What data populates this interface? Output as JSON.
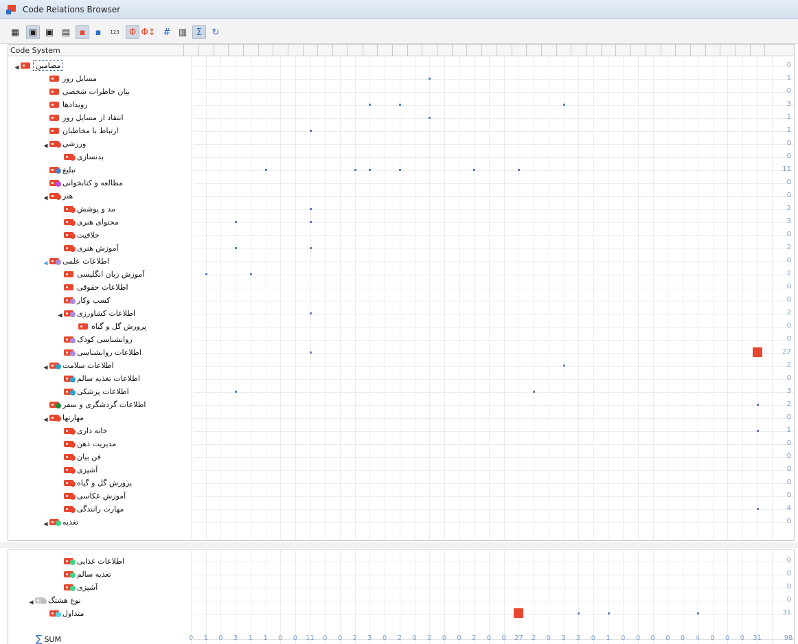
{
  "window": {
    "title": "Code Relations Browser"
  },
  "toolbar": {
    "buttons": [
      {
        "name": "table-view-button",
        "glyph": "▦",
        "on": false
      },
      {
        "name": "layout-a-button",
        "glyph": "▣",
        "on": true
      },
      {
        "name": "layout-b-button",
        "glyph": "▣",
        "on": false
      },
      {
        "name": "layout-c-button",
        "glyph": "▤",
        "on": false
      },
      {
        "name": "symbol-squares-button",
        "glyph": "▪",
        "on": true,
        "color": "#e8472f"
      },
      {
        "name": "symbol-size-button",
        "glyph": "▪",
        "on": false,
        "color": "#2d6fc7"
      },
      {
        "name": "numbers-button",
        "glyph": "123",
        "on": false
      },
      {
        "name": "intersection-button",
        "glyph": "Φ",
        "on": true,
        "color": "#e8472f"
      },
      {
        "name": "proximity-button",
        "glyph": "Φ↕",
        "on": false,
        "color": "#e8472f"
      },
      {
        "name": "hash-button",
        "glyph": "#",
        "on": false,
        "color": "#2d6fc7"
      },
      {
        "name": "columns-button",
        "glyph": "▥",
        "on": false
      },
      {
        "name": "sum-button",
        "glyph": "Σ",
        "on": true,
        "color": "#2d6fc7"
      },
      {
        "name": "refresh-button",
        "glyph": "↻",
        "on": false,
        "color": "#2d6fc7"
      }
    ]
  },
  "header": {
    "column_label": "Code System"
  },
  "colors": {
    "accent": "#e8472f",
    "marker": "#4f7fc4",
    "sum": "#7a9fd0"
  },
  "tree": [
    {
      "label": "مضامین",
      "indent": 0,
      "expand": "▲",
      "dot": "",
      "selected": true,
      "sum": "0",
      "marks": []
    },
    {
      "label": "مسایل روز",
      "indent": 2,
      "expand": "",
      "dot": "",
      "sum": "1",
      "marks": [
        {
          "c": 16
        }
      ]
    },
    {
      "label": "بیان خاطرات شخصی",
      "indent": 2,
      "expand": "",
      "dot": "",
      "sum": "0",
      "marks": []
    },
    {
      "label": "رویدادها",
      "indent": 2,
      "expand": "",
      "dot": "",
      "sum": "3",
      "marks": [
        {
          "c": 12
        },
        {
          "c": 14
        },
        {
          "c": 25
        }
      ]
    },
    {
      "label": "انتقاد از مسایل روز",
      "indent": 2,
      "expand": "",
      "dot": "",
      "sum": "1",
      "marks": [
        {
          "c": 16
        }
      ]
    },
    {
      "label": "ارتباط با مخاطبان",
      "indent": 2,
      "expand": "",
      "dot": "",
      "sum": "1",
      "marks": [
        {
          "c": 8
        }
      ]
    },
    {
      "label": "ورزشی",
      "indent": 2,
      "expand": "▲",
      "dot": "#e8472f",
      "sum": "0",
      "marks": []
    },
    {
      "label": "بدنسازی",
      "indent": 3,
      "expand": "",
      "dot": "#e8472f",
      "sum": "0",
      "marks": []
    },
    {
      "label": "تبلیغ",
      "indent": 2,
      "expand": "",
      "dot": "#4f7fc4",
      "sum": "11",
      "marks": [
        {
          "c": 5
        },
        {
          "c": 11
        },
        {
          "c": 12
        },
        {
          "c": 14
        },
        {
          "c": 19
        },
        {
          "c": 22
        }
      ]
    },
    {
      "label": "مطالعه و کتابخوانی",
      "indent": 2,
      "expand": "",
      "dot": "#c34ad8",
      "sum": "0",
      "marks": []
    },
    {
      "label": "هنر",
      "indent": 2,
      "expand": "▲",
      "dot": "#e8472f",
      "sum": "0",
      "marks": []
    },
    {
      "label": "مد و پوشش",
      "indent": 3,
      "expand": "",
      "dot": "#e8472f",
      "sum": "2",
      "marks": [
        {
          "c": 8
        }
      ]
    },
    {
      "label": "محتوای هنری",
      "indent": 3,
      "expand": "",
      "dot": "#e8472f",
      "sum": "3",
      "marks": [
        {
          "c": 3
        },
        {
          "c": 8
        }
      ]
    },
    {
      "label": "خلاقیت",
      "indent": 3,
      "expand": "",
      "dot": "#e8472f",
      "sum": "0",
      "marks": []
    },
    {
      "label": "آموزش هنری",
      "indent": 3,
      "expand": "",
      "dot": "#e8472f",
      "sum": "2",
      "marks": [
        {
          "c": 3
        },
        {
          "c": 8
        }
      ]
    },
    {
      "label": "اطلاعات علمی",
      "indent": 2,
      "expand": "▲",
      "expandBlue": true,
      "dot": "#a98be0",
      "sum": "0",
      "marks": []
    },
    {
      "label": "آموزش زبان انگلیسی",
      "indent": 3,
      "expand": "",
      "dot": "",
      "sum": "2",
      "marks": [
        {
          "c": 1
        },
        {
          "c": 4
        }
      ]
    },
    {
      "label": "اطلاعات حقوقی",
      "indent": 3,
      "expand": "",
      "dot": "",
      "sum": "0",
      "marks": []
    },
    {
      "label": "کسب وکار",
      "indent": 3,
      "expand": "",
      "dot": "#a98be0",
      "sum": "0",
      "marks": []
    },
    {
      "label": "اطلاعات کشاورزی",
      "indent": 3,
      "expand": "▲",
      "dot": "#a98be0",
      "sum": "2",
      "marks": [
        {
          "c": 8
        }
      ]
    },
    {
      "label": "پرورش گل و گیاه",
      "indent": 4,
      "expand": "",
      "dot": "",
      "sum": "0",
      "marks": []
    },
    {
      "label": "روانشناسی کودک",
      "indent": 3,
      "expand": "",
      "dot": "#a98be0",
      "sum": "0",
      "marks": []
    },
    {
      "label": "اطلاعات روانشناسی",
      "indent": 3,
      "expand": "",
      "dot": "#a98be0",
      "sum": "27",
      "marks": [
        {
          "c": 8
        }
      ],
      "big": [
        {
          "c": 38
        }
      ]
    },
    {
      "label": "اطلاعات سلامت",
      "indent": 2,
      "expand": "▲",
      "dot": "#2aa3c8",
      "sum": "2",
      "marks": [
        {
          "c": 25
        }
      ]
    },
    {
      "label": "اطلاعات تغذیه سالم",
      "indent": 3,
      "expand": "",
      "dot": "#2aa3c8",
      "sum": "0",
      "marks": []
    },
    {
      "label": "اطلاعات پزشکی",
      "indent": 3,
      "expand": "",
      "dot": "#2aa3c8",
      "sum": "3",
      "marks": [
        {
          "c": 3
        },
        {
          "c": 23
        }
      ]
    },
    {
      "label": "اطلاعات گردشگری و سفر",
      "indent": 2,
      "expand": "",
      "dot": "#1f8a3a",
      "sum": "2",
      "marks": [
        {
          "c": 38
        }
      ]
    },
    {
      "label": "مهارتها",
      "indent": 2,
      "expand": "▲",
      "dot": "#e8472f",
      "sum": "0",
      "marks": []
    },
    {
      "label": "خانه داری",
      "indent": 3,
      "expand": "",
      "dot": "#e8472f",
      "sum": "1",
      "marks": [
        {
          "c": 38
        }
      ]
    },
    {
      "label": "مدیریت ذهن",
      "indent": 3,
      "expand": "",
      "dot": "#e8472f",
      "sum": "0",
      "marks": []
    },
    {
      "label": "فن بیان",
      "indent": 3,
      "expand": "",
      "dot": "#e8472f",
      "sum": "0",
      "marks": []
    },
    {
      "label": "آشپزی",
      "indent": 3,
      "expand": "",
      "dot": "#e8472f",
      "sum": "0",
      "marks": []
    },
    {
      "label": "پرورش گل و گیاه",
      "indent": 3,
      "expand": "",
      "dot": "#e8472f",
      "sum": "0",
      "marks": []
    },
    {
      "label": "آموزش عکاسی",
      "indent": 3,
      "expand": "",
      "dot": "#e8472f",
      "sum": "0",
      "marks": []
    },
    {
      "label": "مهارت رانندگی",
      "indent": 3,
      "expand": "",
      "dot": "#e8472f",
      "sum": "4",
      "marks": [
        {
          "c": 38
        }
      ]
    },
    {
      "label": "تغذیه",
      "indent": 2,
      "expand": "▲",
      "dot": "#3fd68a",
      "sum": "0",
      "marks": []
    }
  ],
  "tree_bottom": [
    {
      "label": "اطلاعات غذایی",
      "indent": 3,
      "expand": "",
      "dot": "#3fd68a",
      "sum": "0",
      "marks": []
    },
    {
      "label": "تغذیه سالم",
      "indent": 3,
      "expand": "",
      "dot": "#3fd68a",
      "sum": "0",
      "marks": []
    },
    {
      "label": "آشپزی",
      "indent": 3,
      "expand": "",
      "dot": "#3fd68a",
      "sum": "0",
      "marks": []
    },
    {
      "label": "نوع هشتگ",
      "indent": 1,
      "expand": "▲",
      "dot": "#bbbbbb",
      "grey": true,
      "sum": "0",
      "marks": []
    },
    {
      "label": "متداول",
      "indent": 2,
      "expand": "",
      "dot": "#4fd8e8",
      "sum": "31",
      "marks": [
        {
          "c": 26
        },
        {
          "c": 28
        },
        {
          "c": 34
        }
      ],
      "big": [
        {
          "c": 22
        }
      ]
    }
  ],
  "sum_row": {
    "label": "SUM",
    "values": [
      "0",
      "1",
      "0",
      "3",
      "1",
      "1",
      "0",
      "0",
      "11",
      "0",
      "0",
      "2",
      "3",
      "0",
      "2",
      "0",
      "2",
      "0",
      "0",
      "2",
      "0",
      "0",
      "27",
      "2",
      "0",
      "3",
      "2",
      "0",
      "1",
      "0",
      "0",
      "0",
      "0",
      "0",
      "4",
      "0",
      "0",
      "0",
      "31",
      "98"
    ]
  }
}
